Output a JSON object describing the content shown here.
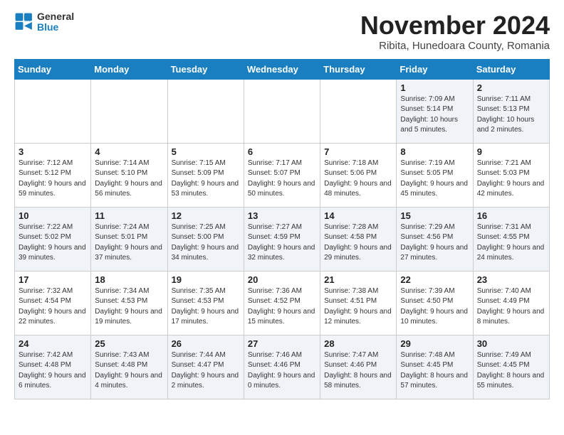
{
  "header": {
    "logo_text_top": "General",
    "logo_text_bottom": "Blue",
    "month": "November 2024",
    "location": "Ribita, Hunedoara County, Romania"
  },
  "weekdays": [
    "Sunday",
    "Monday",
    "Tuesday",
    "Wednesday",
    "Thursday",
    "Friday",
    "Saturday"
  ],
  "weeks": [
    [
      {
        "day": "",
        "info": ""
      },
      {
        "day": "",
        "info": ""
      },
      {
        "day": "",
        "info": ""
      },
      {
        "day": "",
        "info": ""
      },
      {
        "day": "",
        "info": ""
      },
      {
        "day": "1",
        "info": "Sunrise: 7:09 AM\nSunset: 5:14 PM\nDaylight: 10 hours and 5 minutes."
      },
      {
        "day": "2",
        "info": "Sunrise: 7:11 AM\nSunset: 5:13 PM\nDaylight: 10 hours and 2 minutes."
      }
    ],
    [
      {
        "day": "3",
        "info": "Sunrise: 7:12 AM\nSunset: 5:12 PM\nDaylight: 9 hours and 59 minutes."
      },
      {
        "day": "4",
        "info": "Sunrise: 7:14 AM\nSunset: 5:10 PM\nDaylight: 9 hours and 56 minutes."
      },
      {
        "day": "5",
        "info": "Sunrise: 7:15 AM\nSunset: 5:09 PM\nDaylight: 9 hours and 53 minutes."
      },
      {
        "day": "6",
        "info": "Sunrise: 7:17 AM\nSunset: 5:07 PM\nDaylight: 9 hours and 50 minutes."
      },
      {
        "day": "7",
        "info": "Sunrise: 7:18 AM\nSunset: 5:06 PM\nDaylight: 9 hours and 48 minutes."
      },
      {
        "day": "8",
        "info": "Sunrise: 7:19 AM\nSunset: 5:05 PM\nDaylight: 9 hours and 45 minutes."
      },
      {
        "day": "9",
        "info": "Sunrise: 7:21 AM\nSunset: 5:03 PM\nDaylight: 9 hours and 42 minutes."
      }
    ],
    [
      {
        "day": "10",
        "info": "Sunrise: 7:22 AM\nSunset: 5:02 PM\nDaylight: 9 hours and 39 minutes."
      },
      {
        "day": "11",
        "info": "Sunrise: 7:24 AM\nSunset: 5:01 PM\nDaylight: 9 hours and 37 minutes."
      },
      {
        "day": "12",
        "info": "Sunrise: 7:25 AM\nSunset: 5:00 PM\nDaylight: 9 hours and 34 minutes."
      },
      {
        "day": "13",
        "info": "Sunrise: 7:27 AM\nSunset: 4:59 PM\nDaylight: 9 hours and 32 minutes."
      },
      {
        "day": "14",
        "info": "Sunrise: 7:28 AM\nSunset: 4:58 PM\nDaylight: 9 hours and 29 minutes."
      },
      {
        "day": "15",
        "info": "Sunrise: 7:29 AM\nSunset: 4:56 PM\nDaylight: 9 hours and 27 minutes."
      },
      {
        "day": "16",
        "info": "Sunrise: 7:31 AM\nSunset: 4:55 PM\nDaylight: 9 hours and 24 minutes."
      }
    ],
    [
      {
        "day": "17",
        "info": "Sunrise: 7:32 AM\nSunset: 4:54 PM\nDaylight: 9 hours and 22 minutes."
      },
      {
        "day": "18",
        "info": "Sunrise: 7:34 AM\nSunset: 4:53 PM\nDaylight: 9 hours and 19 minutes."
      },
      {
        "day": "19",
        "info": "Sunrise: 7:35 AM\nSunset: 4:53 PM\nDaylight: 9 hours and 17 minutes."
      },
      {
        "day": "20",
        "info": "Sunrise: 7:36 AM\nSunset: 4:52 PM\nDaylight: 9 hours and 15 minutes."
      },
      {
        "day": "21",
        "info": "Sunrise: 7:38 AM\nSunset: 4:51 PM\nDaylight: 9 hours and 12 minutes."
      },
      {
        "day": "22",
        "info": "Sunrise: 7:39 AM\nSunset: 4:50 PM\nDaylight: 9 hours and 10 minutes."
      },
      {
        "day": "23",
        "info": "Sunrise: 7:40 AM\nSunset: 4:49 PM\nDaylight: 9 hours and 8 minutes."
      }
    ],
    [
      {
        "day": "24",
        "info": "Sunrise: 7:42 AM\nSunset: 4:48 PM\nDaylight: 9 hours and 6 minutes."
      },
      {
        "day": "25",
        "info": "Sunrise: 7:43 AM\nSunset: 4:48 PM\nDaylight: 9 hours and 4 minutes."
      },
      {
        "day": "26",
        "info": "Sunrise: 7:44 AM\nSunset: 4:47 PM\nDaylight: 9 hours and 2 minutes."
      },
      {
        "day": "27",
        "info": "Sunrise: 7:46 AM\nSunset: 4:46 PM\nDaylight: 9 hours and 0 minutes."
      },
      {
        "day": "28",
        "info": "Sunrise: 7:47 AM\nSunset: 4:46 PM\nDaylight: 8 hours and 58 minutes."
      },
      {
        "day": "29",
        "info": "Sunrise: 7:48 AM\nSunset: 4:45 PM\nDaylight: 8 hours and 57 minutes."
      },
      {
        "day": "30",
        "info": "Sunrise: 7:49 AM\nSunset: 4:45 PM\nDaylight: 8 hours and 55 minutes."
      }
    ]
  ]
}
